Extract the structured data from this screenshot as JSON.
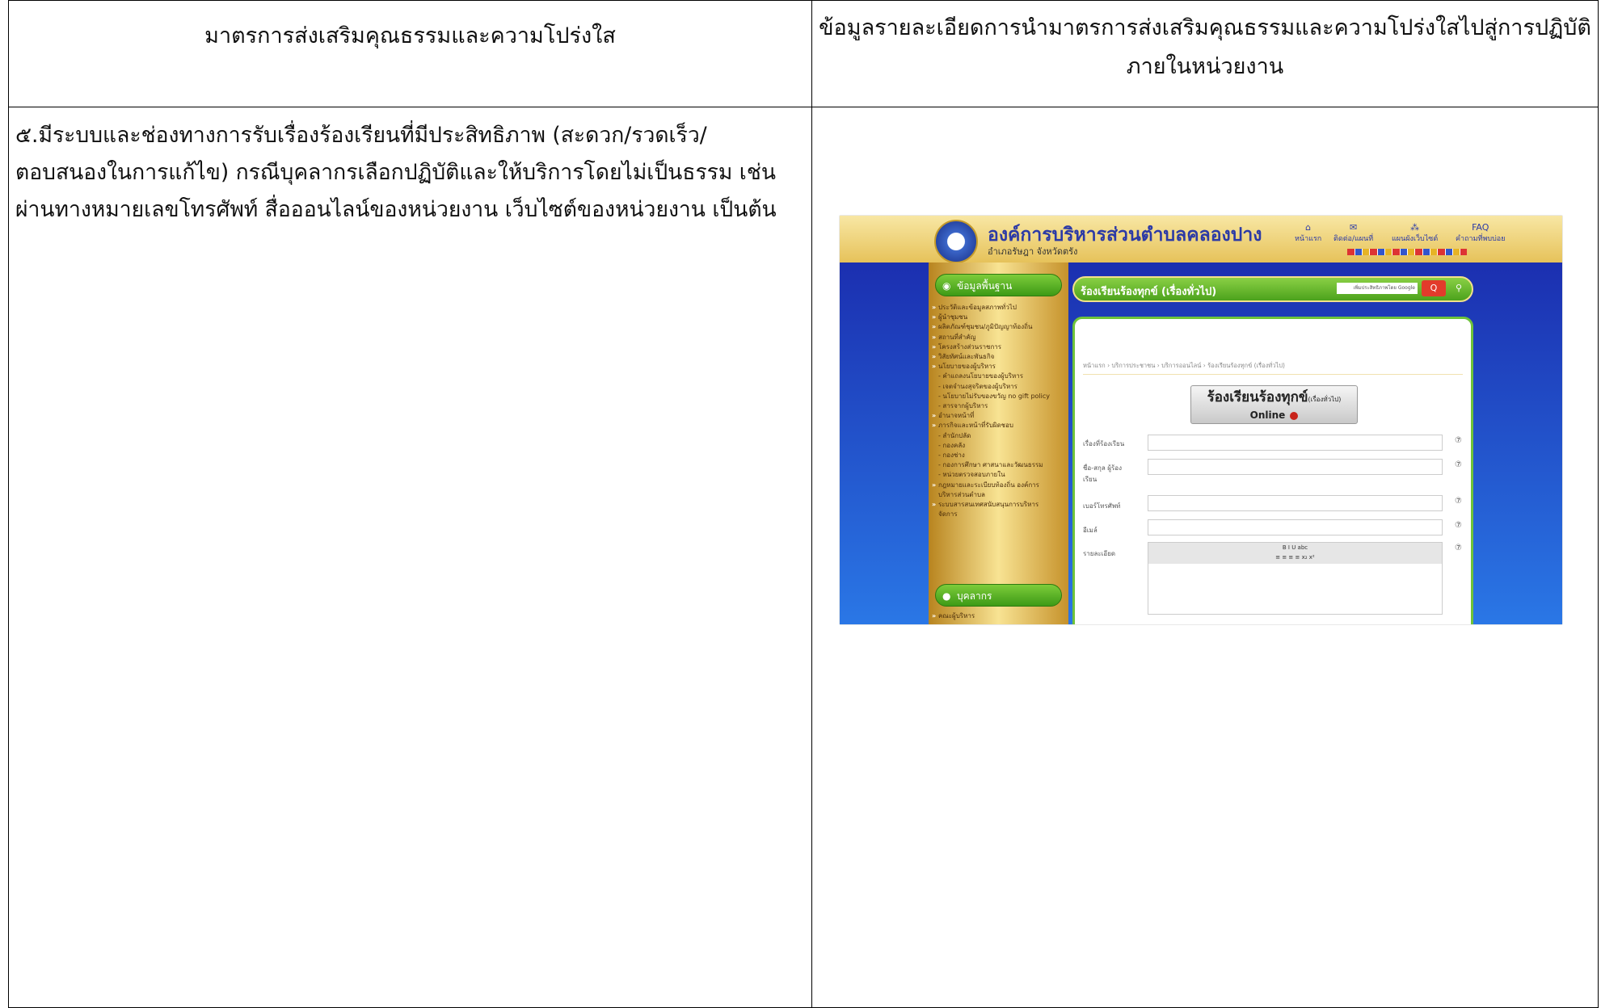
{
  "table": {
    "header_left": "มาตรการส่งเสริมคุณธรรมและความโปร่งใส",
    "header_right_line1": "ข้อมูลรายละเอียดการนำมาตรการส่งเสริมคุณธรรมและความโปร่งใสไปสู่การปฏิบัติ",
    "header_right_line2": "ภายในหน่วยงาน",
    "measure_line1": "๕.มีระบบและช่องทางการรับเรื่องร้องเรียนที่มีประสิทธิภาพ (สะดวก/รวดเร็ว/",
    "measure_line2": "ตอบสนองในการแก้ไข) กรณีบุคลากรเลือกปฏิบัติและให้บริการโดยไม่เป็นธรรม เช่น",
    "measure_line3": "ผ่านทางหมายเลขโทรศัพท์ สื่อออนไลน์ของหน่วยงาน เว็บไซต์ของหน่วยงาน เป็นต้น"
  },
  "screenshot": {
    "org_name": "องค์การบริหารส่วนตำบลคลองปาง",
    "org_sub": "อำเภอรัษฎา จังหวัดตรัง",
    "nav": [
      {
        "label": "หน้าแรก",
        "icon": "home-icon",
        "glyph": "⌂"
      },
      {
        "label": "ติดต่อ/แผนที่",
        "icon": "mail-icon",
        "glyph": "✉"
      },
      {
        "label": "แผนผังเว็บไซต์",
        "icon": "sitemap-icon",
        "glyph": "⁂"
      },
      {
        "label": "คำถามที่พบบ่อย",
        "icon": "faq-icon",
        "glyph": "FAQ"
      }
    ],
    "sidebar": {
      "basic_info_label": "ข้อมูลพื้นฐาน",
      "items": [
        {
          "text": "ประวัติและข้อมูลสภาพทั่วไป",
          "sub": false
        },
        {
          "text": "ผู้นำชุมชน",
          "sub": false
        },
        {
          "text": "ผลิตภัณฑ์ชุมชน/ภูมิปัญญาท้องถิ่น",
          "sub": false
        },
        {
          "text": "สถานที่สำคัญ",
          "sub": false
        },
        {
          "text": "โครงสร้างส่วนราชการ",
          "sub": false
        },
        {
          "text": "วิสัยทัศน์และพันธกิจ",
          "sub": false
        },
        {
          "text": "นโยบายของผู้บริหาร",
          "sub": false
        },
        {
          "text": "- คำแถลงนโยบายของผู้บริหาร",
          "sub": true
        },
        {
          "text": "- เจตจำนงสุจริตของผู้บริหาร",
          "sub": true
        },
        {
          "text": "- นโยบายไม่รับของขวัญ no gift policy",
          "sub": true
        },
        {
          "text": "- สารจากผู้บริหาร",
          "sub": true
        },
        {
          "text": "อำนาจหน้าที่",
          "sub": false
        },
        {
          "text": "ภารกิจและหน้าที่รับผิดชอบ",
          "sub": false
        },
        {
          "text": "- สำนักปลัด",
          "sub": true
        },
        {
          "text": "- กองคลัง",
          "sub": true
        },
        {
          "text": "- กองช่าง",
          "sub": true
        },
        {
          "text": "- กองการศึกษา ศาสนาและวัฒนธรรม",
          "sub": true
        },
        {
          "text": "- หน่วยตรวจสอบภายใน",
          "sub": true
        },
        {
          "text": "กฎหมายและระเบียบท้องถิ่น องค์การ",
          "sub": false
        },
        {
          "text": "บริหารส่วนตำบล",
          "sub": true
        },
        {
          "text": "ระบบสารสนเทศสนับสนุนการบริหาร",
          "sub": false
        },
        {
          "text": "จัดการ",
          "sub": true
        }
      ],
      "personnel_label": "บุคลากร",
      "after_items": [
        {
          "text": "คณะผู้บริหาร",
          "sub": false
        }
      ]
    },
    "main": {
      "title": "ร้องเรียนร้องทุกข์ (เรื่องทั่วไป)",
      "search_placeholder": "เพิ่มประสิทธิภาพโดย Google",
      "search_button": "Q",
      "breadcrumb": "หน้าแรก › บริการประชาชน › บริการออนไลน์ › ร้องเรียนร้องทุกข์ (เรื่องทั่วไป)",
      "online_title": "ร้องเรียนร้องทุกข์",
      "online_small": "(เรื่องทั่วไป)",
      "online_label": "Online",
      "fields": [
        {
          "label": "เรื่องที่ร้องเรียน"
        },
        {
          "label": "ชื่อ-สกุล ผู้ร้องเรียน"
        },
        {
          "label": "เบอร์โทรศัพท์"
        },
        {
          "label": "อีเมล์"
        },
        {
          "label": "รายละเอียด"
        }
      ],
      "help_glyph": "⑦",
      "editor_toolbar_line1": "B  I  U  abc",
      "editor_toolbar_line2": "≡ ≡ ≡ ≡  x₂ x²"
    }
  }
}
